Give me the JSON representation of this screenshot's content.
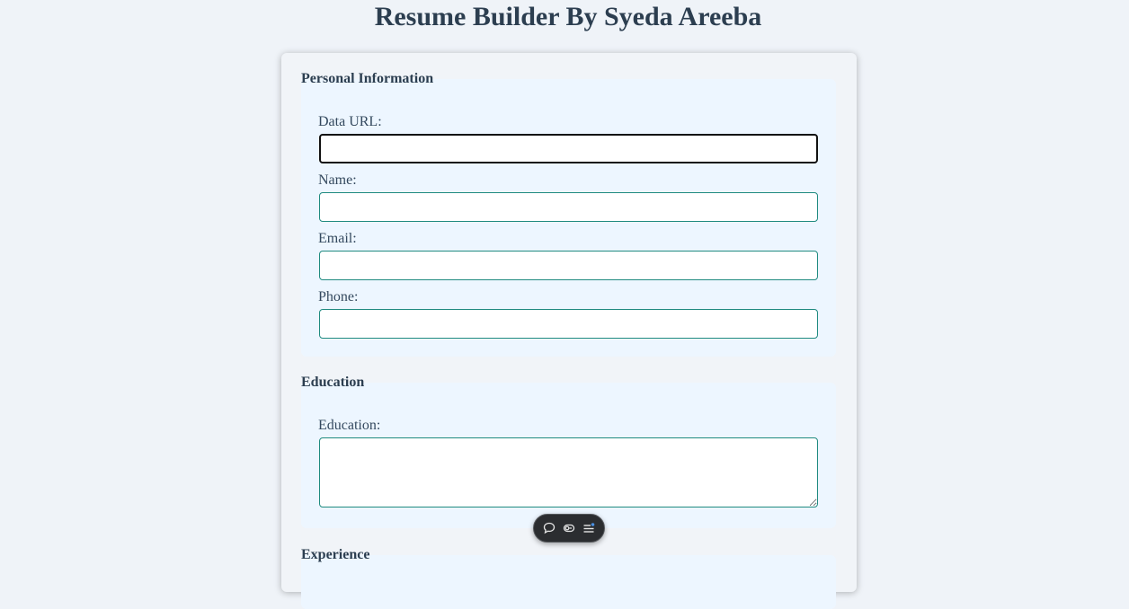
{
  "page": {
    "title": "Resume Builder By Syeda Areeba"
  },
  "personal": {
    "section_title": "Personal Information",
    "data_url_label": "Data URL:",
    "data_url_value": "",
    "name_label": "Name:",
    "name_value": "",
    "email_label": "Email:",
    "email_value": "",
    "phone_label": "Phone:",
    "phone_value": ""
  },
  "education": {
    "section_title": "Education",
    "education_label": "Education:",
    "education_value": ""
  },
  "experience": {
    "section_title": "Experience"
  },
  "toolbar": {
    "icons": [
      "comment-icon",
      "toggle-icon",
      "list-menu-icon"
    ]
  },
  "colors": {
    "background": "#eff3f8",
    "section_background": "#edf6ff",
    "input_border": "#1f8a80",
    "heading_text": "#2c3e50",
    "toolbar_background": "#2b2d30",
    "toolbar_accent": "#4a90e2"
  }
}
